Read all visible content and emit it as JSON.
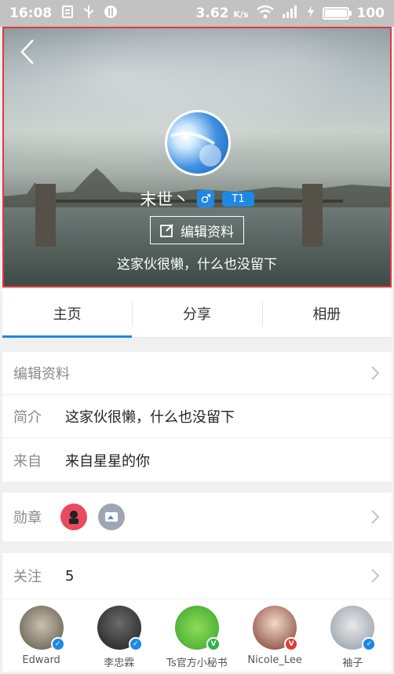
{
  "status_bar": {
    "time": "16:08",
    "speed": "3.62",
    "speed_unit": "K/s",
    "battery": "100",
    "battery_level": 1.0
  },
  "profile": {
    "name": "末世丶",
    "gender_symbol": "♂",
    "level": "T1",
    "edit_button": "编辑资料",
    "tagline": "这家伙很懒，什么也没留下"
  },
  "tabs": [
    {
      "label": "主页",
      "active": true
    },
    {
      "label": "分享",
      "active": false
    },
    {
      "label": "相册",
      "active": false
    }
  ],
  "info": {
    "edit_label": "编辑资料",
    "intro_label": "简介",
    "intro_value": "这家伙很懒，什么也没留下",
    "from_label": "来自",
    "from_value": "来自星星的你"
  },
  "medals": {
    "label": "勋章"
  },
  "follow": {
    "label": "关注",
    "count": "5"
  },
  "following": [
    {
      "name": "Edward",
      "badge": "blue"
    },
    {
      "name": "李忠霖",
      "badge": "blue"
    },
    {
      "name": "Ts官方小秘书",
      "badge": "green"
    },
    {
      "name": "Nicole_Lee",
      "badge": "red"
    },
    {
      "name": "袖子",
      "badge": "blue"
    }
  ],
  "colors": {
    "accent": "#1e88e5",
    "frame": "#e0393e"
  }
}
